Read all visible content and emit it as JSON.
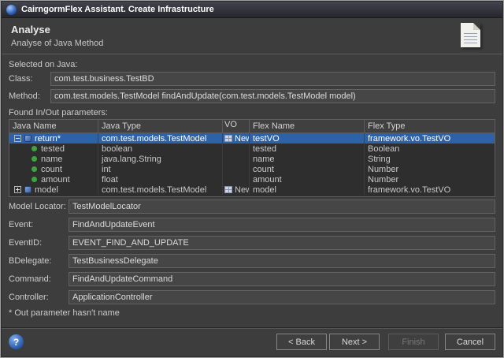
{
  "window": {
    "title": "CairngormFlex Assistant. Create Infrastructure"
  },
  "header": {
    "title": "Analyse",
    "subtitle": "Analyse of Java Method"
  },
  "selected_java": {
    "group_label": "Selected on Java:",
    "class_label": "Class:",
    "class_value": "com.test.business.TestBD",
    "method_label": "Method:",
    "method_value": "com.test.models.TestModel findAndUpdate(com.test.models.TestModel model)"
  },
  "parameters_table": {
    "label": "Found In/Out parameters:",
    "columns": {
      "java_name": "Java Name",
      "java_type": "Java Type",
      "vo": "VO",
      "flex_name": "Flex Name",
      "flex_type": "Flex Type"
    },
    "rows": [
      {
        "java_name": "return*",
        "java_type": "com.test.models.TestModel",
        "vo": "New",
        "flex_name": "testVO",
        "flex_type": "framework.vo.TestVO",
        "expanded": true,
        "selected": true
      },
      {
        "java_name": "tested",
        "java_type": "boolean",
        "vo": "",
        "flex_name": "tested",
        "flex_type": "Boolean",
        "expanded": null,
        "selected": false
      },
      {
        "java_name": "name",
        "java_type": "java.lang.String",
        "vo": "",
        "flex_name": "name",
        "flex_type": "String",
        "expanded": null,
        "selected": false
      },
      {
        "java_name": "count",
        "java_type": "int",
        "vo": "",
        "flex_name": "count",
        "flex_type": "Number",
        "expanded": null,
        "selected": false
      },
      {
        "java_name": "amount",
        "java_type": "float",
        "vo": "",
        "flex_name": "amount",
        "flex_type": "Number",
        "expanded": null,
        "selected": false
      },
      {
        "java_name": "model",
        "java_type": "com.test.models.TestModel",
        "vo": "New",
        "flex_name": "model",
        "flex_type": "framework.vo.TestVO",
        "expanded": false,
        "selected": false
      }
    ]
  },
  "fields": [
    {
      "label": "Model Locator:",
      "value": "TestModelLocator"
    },
    {
      "label": "Event:",
      "value": "FindAndUpdateEvent"
    },
    {
      "label": "EventID:",
      "value": "EVENT_FIND_AND_UPDATE"
    },
    {
      "label": "BDelegate:",
      "value": "TestBusinessDelegate"
    },
    {
      "label": "Command:",
      "value": "FindAndUpdateCommand"
    },
    {
      "label": "Controller:",
      "value": "ApplicationController"
    }
  ],
  "footnote": "* Out parameter hasn't name",
  "buttons": {
    "back": "< Back",
    "next": "Next >",
    "finish": "Finish",
    "cancel": "Cancel"
  },
  "icons": {
    "help": "?"
  },
  "colors": {
    "selection": "#2d62a8",
    "background": "#3d3d3d",
    "titlebar": "#2c2c34"
  }
}
